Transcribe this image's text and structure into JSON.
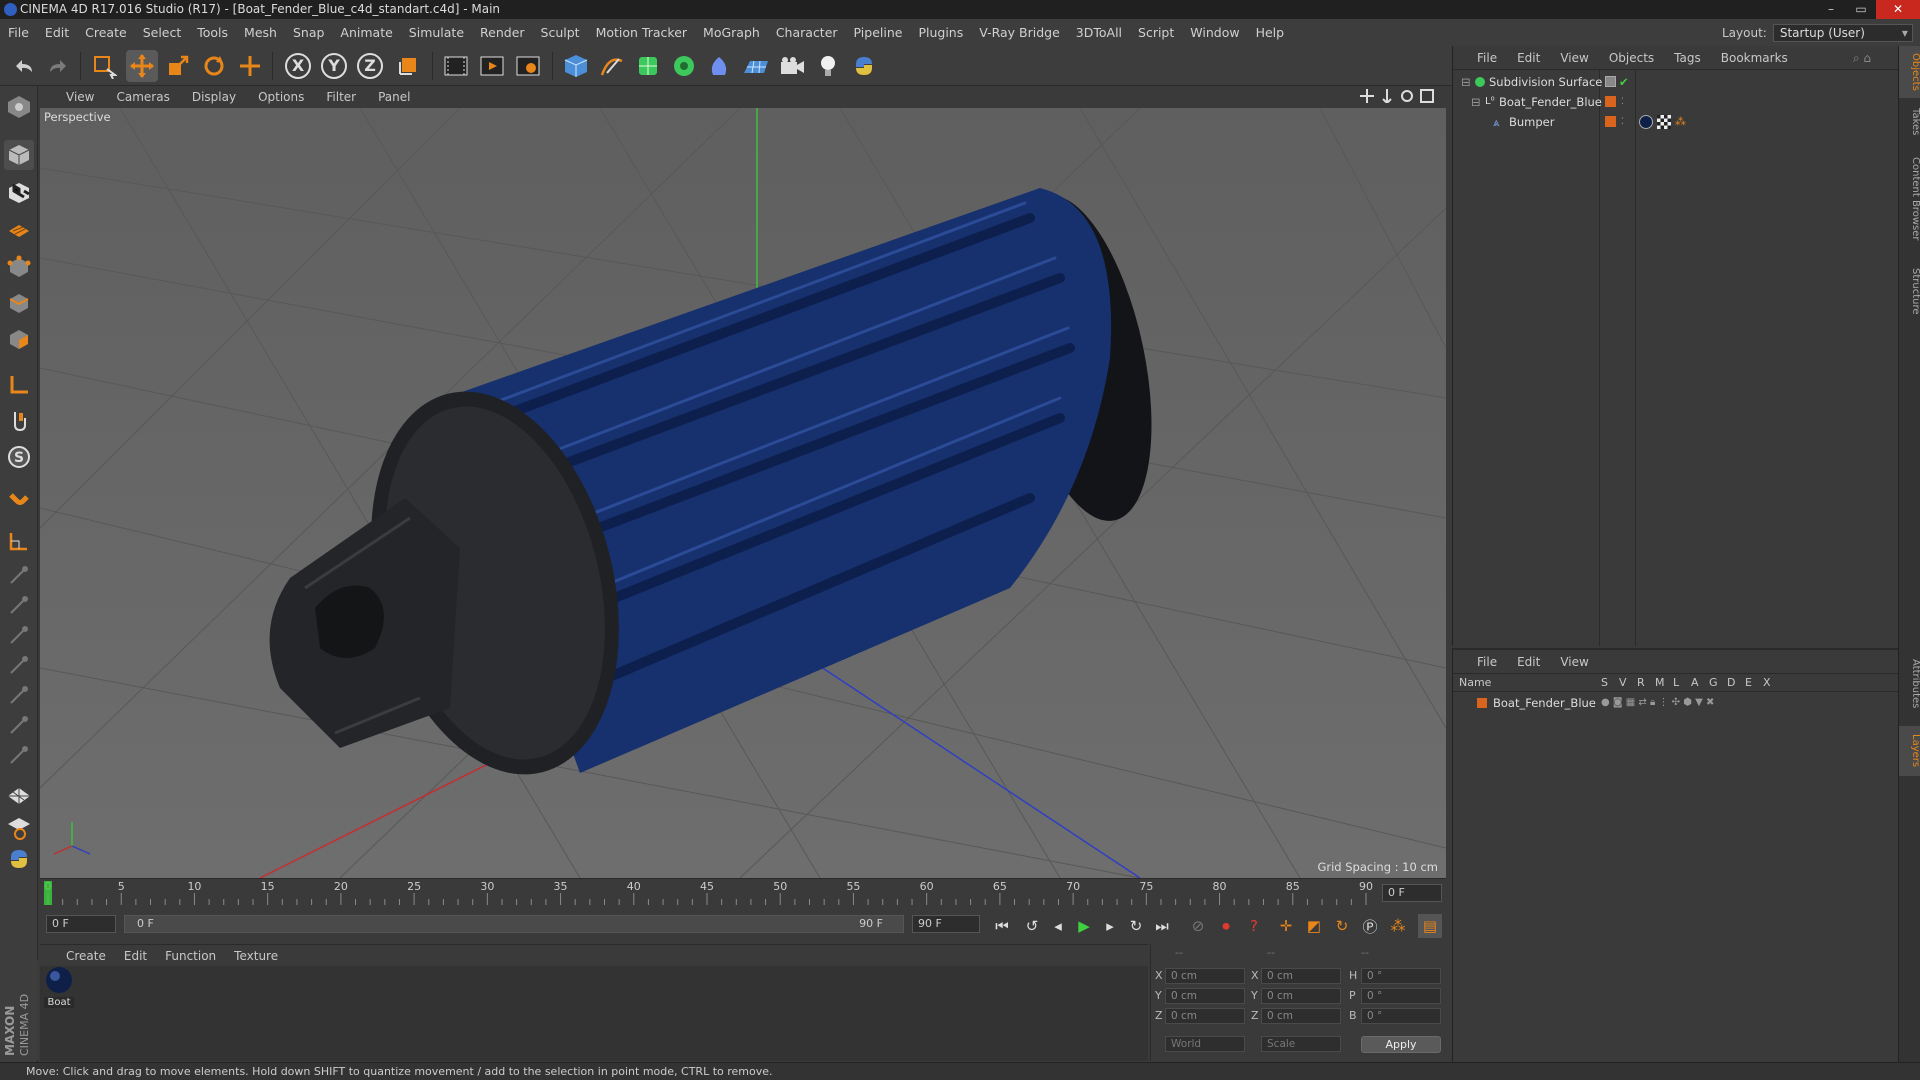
{
  "window": {
    "title": "CINEMA 4D R17.016 Studio (R17) - [Boat_Fender_Blue_c4d_standart.c4d] - Main",
    "buttons": {
      "minimize": "–",
      "maximize": "▭",
      "close": "✕"
    }
  },
  "menu": [
    "File",
    "Edit",
    "Create",
    "Select",
    "Tools",
    "Mesh",
    "Snap",
    "Animate",
    "Simulate",
    "Render",
    "Sculpt",
    "Motion Tracker",
    "MoGraph",
    "Character",
    "Pipeline",
    "Plugins",
    "V-Ray Bridge",
    "3DToAll",
    "Script",
    "Window",
    "Help"
  ],
  "layout": {
    "label": "Layout:",
    "value": "Startup (User)"
  },
  "toolbar": {
    "x": "X",
    "y": "Y",
    "z": "Z"
  },
  "viewport": {
    "menu": [
      "View",
      "Cameras",
      "Display",
      "Options",
      "Filter",
      "Panel"
    ],
    "label": "Perspective",
    "grid_spacing": "Grid Spacing : 10 cm"
  },
  "timeline": {
    "ticks": [
      "0",
      "5",
      "10",
      "15",
      "20",
      "25",
      "30",
      "35",
      "40",
      "45",
      "50",
      "55",
      "60",
      "65",
      "70",
      "75",
      "80",
      "85",
      "90"
    ],
    "current_frame": "0 F",
    "start": "0 F",
    "range_start": "0 F",
    "range_end": "90 F",
    "end": "90 F"
  },
  "material": {
    "menu": [
      "Create",
      "Edit",
      "Function",
      "Texture"
    ],
    "items": [
      {
        "label": "Boat"
      }
    ]
  },
  "coords": {
    "headers": [
      "--",
      "--",
      "--"
    ],
    "rows": [
      {
        "l1": "X",
        "v1": "0 cm",
        "l2": "X",
        "v2": "0 cm",
        "l3": "H",
        "v3": "0 °"
      },
      {
        "l1": "Y",
        "v1": "0 cm",
        "l2": "Y",
        "v2": "0 cm",
        "l3": "P",
        "v3": "0 °"
      },
      {
        "l1": "Z",
        "v1": "0 cm",
        "l2": "Z",
        "v2": "0 cm",
        "l3": "B",
        "v3": "0 °"
      }
    ],
    "world": "World",
    "scale": "Scale",
    "apply": "Apply"
  },
  "objects": {
    "menu": [
      "File",
      "Edit",
      "View",
      "Objects",
      "Tags",
      "Bookmarks"
    ],
    "items": [
      {
        "name": "Subdivision Surface",
        "indent": 0
      },
      {
        "name": "Boat_Fender_Blue",
        "indent": 1
      },
      {
        "name": "Bumper",
        "indent": 2
      }
    ]
  },
  "layers": {
    "menu": [
      "File",
      "Edit",
      "View"
    ],
    "columns": {
      "name": "Name",
      "flags": [
        "S",
        "V",
        "R",
        "M",
        "L",
        "A",
        "G",
        "D",
        "E",
        "X"
      ]
    },
    "items": [
      {
        "name": "Boat_Fender_Blue"
      }
    ]
  },
  "right_tabs": [
    "Objects",
    "Takes",
    "Content Browser",
    "Structure",
    "Attributes",
    "Layers"
  ],
  "status": "Move: Click and drag to move elements. Hold down SHIFT to quantize movement / add to the selection in point mode, CTRL to remove.",
  "brand": {
    "maxon": "MAXON",
    "cinema": "CINEMA 4D"
  },
  "colors": {
    "accent_orange": "#e8861a",
    "fender_blue": "#17306e",
    "layer_orange": "#d9641e"
  }
}
